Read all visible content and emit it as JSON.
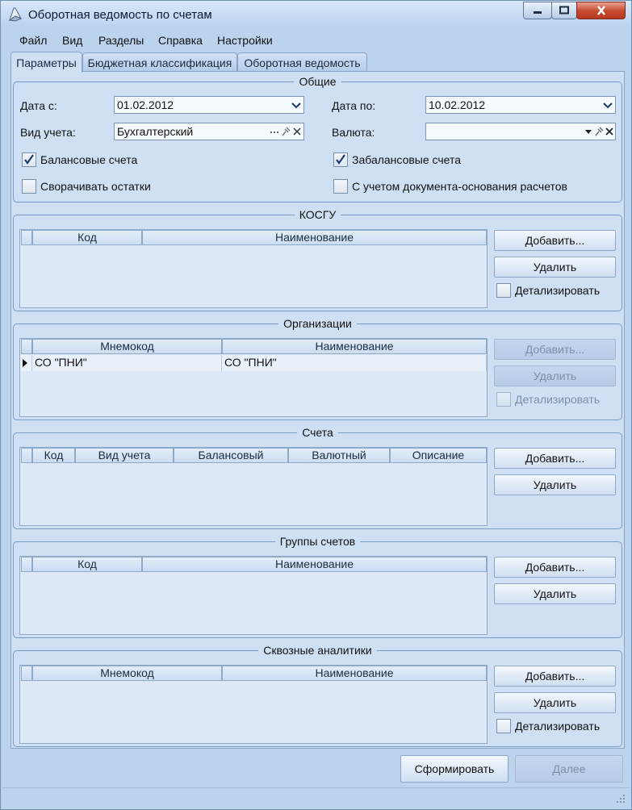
{
  "window": {
    "title": "Оборотная ведомость по счетам"
  },
  "menu": [
    "Файл",
    "Вид",
    "Разделы",
    "Справка",
    "Настройки"
  ],
  "tabs": [
    "Параметры",
    "Бюджетная классификация",
    "Оборотная ведомость"
  ],
  "general": {
    "title": "Общие",
    "date_from_label": "Дата с:",
    "date_from_value": "01.02.2012",
    "date_to_label": "Дата по:",
    "date_to_value": "10.02.2012",
    "account_type_label": "Вид учета:",
    "account_type_value": "Бухгалтерский",
    "currency_label": "Валюта:",
    "currency_value": "",
    "cb_balance": "Балансовые счета",
    "cb_offbalance": "Забалансовые счета",
    "cb_collapse": "Сворачивать остатки",
    "cb_basis_doc": "С учетом документа-основания расчетов"
  },
  "kosgu": {
    "title": "КОСГУ",
    "columns": [
      "Код",
      "Наименование"
    ]
  },
  "orgs": {
    "title": "Организации",
    "columns": [
      "Мнемокод",
      "Наименование"
    ],
    "rows": [
      [
        "СО \"ПНИ\"",
        "СО \"ПНИ\""
      ]
    ]
  },
  "accounts": {
    "title": "Счета",
    "columns": [
      "Код",
      "Вид учета",
      "Балансовый",
      "Валютный",
      "Описание"
    ]
  },
  "acc_groups": {
    "title": "Группы счетов",
    "columns": [
      "Код",
      "Наименование"
    ]
  },
  "analytics": {
    "title": "Сквозные аналитики",
    "columns": [
      "Мнемокод",
      "Наименование"
    ]
  },
  "buttons": {
    "add": "Добавить...",
    "delete": "Удалить",
    "detail": "Детализировать",
    "form": "Сформировать",
    "next": "Далее"
  },
  "colors": {
    "window_bg": "#bcd3ee",
    "panel_bg": "#cfe0f5",
    "grid_bg": "#dde9f7",
    "close_red": "#c44a2f"
  },
  "icons": [
    "app-icon",
    "minimize-icon",
    "maximize-icon",
    "close-icon",
    "chevron-down-icon",
    "ellipsis-icon",
    "pin-icon",
    "clear-icon",
    "check-icon",
    "row-pointer-icon",
    "resize-grip-icon"
  ]
}
